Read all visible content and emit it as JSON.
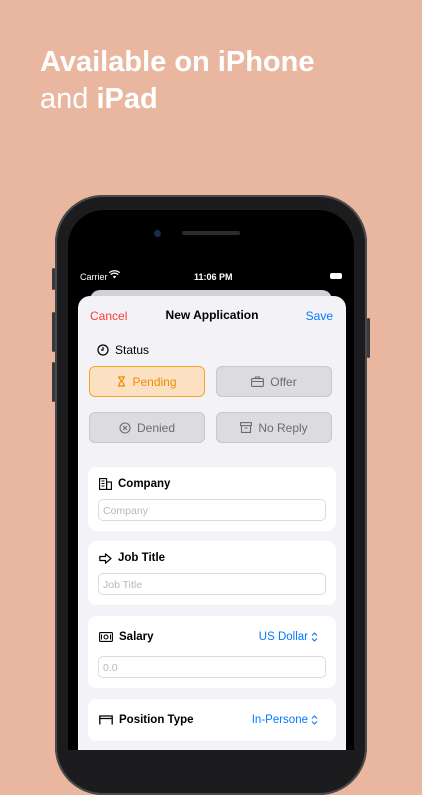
{
  "headline": {
    "line1": "Available on iPhone",
    "line2_light": "and ",
    "line2_bold": "iPad"
  },
  "status_bar": {
    "carrier": "Carrier",
    "time": "11:06 PM"
  },
  "nav": {
    "cancel": "Cancel",
    "title": "New Application",
    "save": "Save"
  },
  "status": {
    "label": "Status",
    "options": [
      {
        "label": "Pending",
        "icon": "hourglass-icon",
        "selected": true
      },
      {
        "label": "Offer",
        "icon": "briefcase-icon",
        "selected": false
      },
      {
        "label": "Denied",
        "icon": "x-circle-icon",
        "selected": false
      },
      {
        "label": "No Reply",
        "icon": "archive-box-icon",
        "selected": false
      }
    ]
  },
  "company": {
    "label": "Company",
    "placeholder": "Company",
    "icon": "building-icon"
  },
  "job_title": {
    "label": "Job Title",
    "placeholder": "Job Title",
    "icon": "arrow-right-icon"
  },
  "salary": {
    "label": "Salary",
    "placeholder": "0.0",
    "currency": "US Dollar",
    "icon": "banknote-icon"
  },
  "position_type": {
    "label": "Position Type",
    "value": "In-Persone",
    "icon": "table-icon"
  },
  "colors": {
    "background": "#e9b7a0",
    "accent": "#007aff",
    "cancel": "#ff3b30",
    "pending": "#f08c00"
  }
}
